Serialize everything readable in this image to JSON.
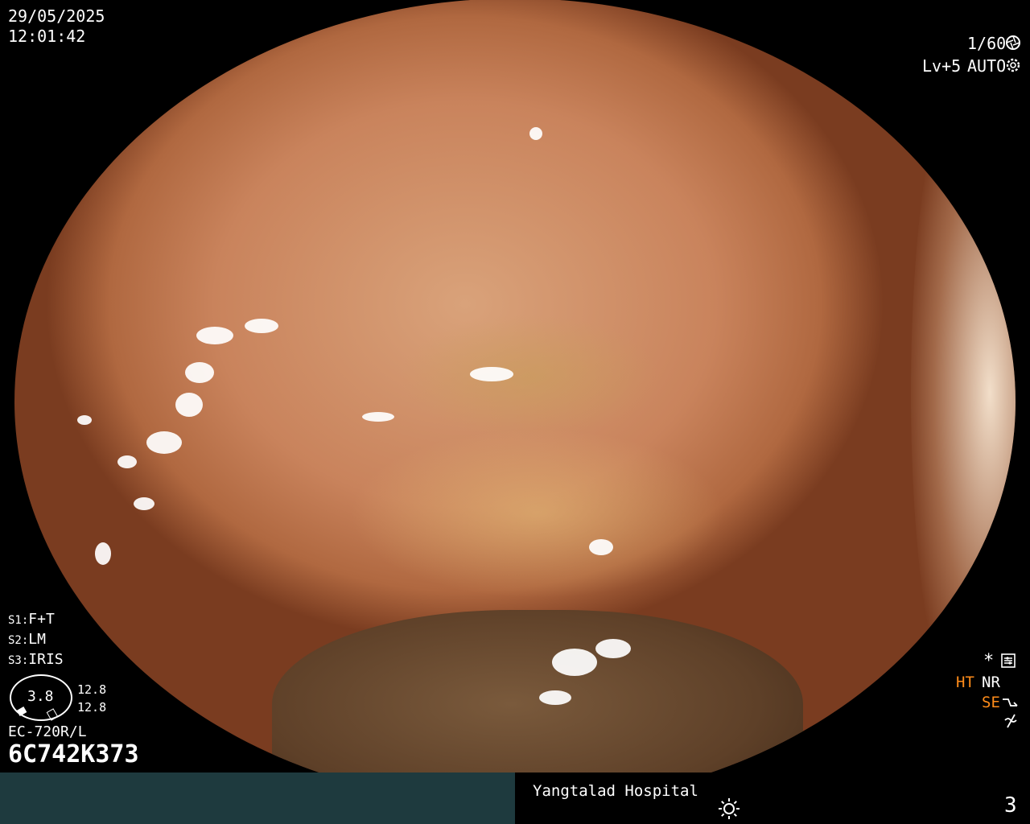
{
  "status": {
    "date": "29/05/2025",
    "time": "12:01:42",
    "shutter": "1/60",
    "level": "Lv+5",
    "iris_mode": "AUTO"
  },
  "settings": {
    "s1_key": "S1:",
    "s1_value": "F+T",
    "s2_key": "S2:",
    "s2_value": "LM",
    "s3_key": "S3:",
    "s3_value": "IRIS"
  },
  "scope": {
    "index_value": "3.8",
    "range_top": "12.8",
    "range_bottom": "12.8",
    "model": "EC-720R/L",
    "serial": "6C742K373"
  },
  "indicators": {
    "star": "*",
    "ht": "HT",
    "nr": "NR",
    "se": "SE",
    "ht_color": "#ff8c1a",
    "se_color": "#ff8c1a"
  },
  "footer": {
    "hospital": "Yangtalad Hospital",
    "page_number": "3",
    "left_color": "#1e3a3e"
  },
  "icons": [
    "aperture-icon",
    "gear-icon",
    "settings-icon",
    "tone-icon",
    "wave-icon",
    "brightness-icon"
  ]
}
